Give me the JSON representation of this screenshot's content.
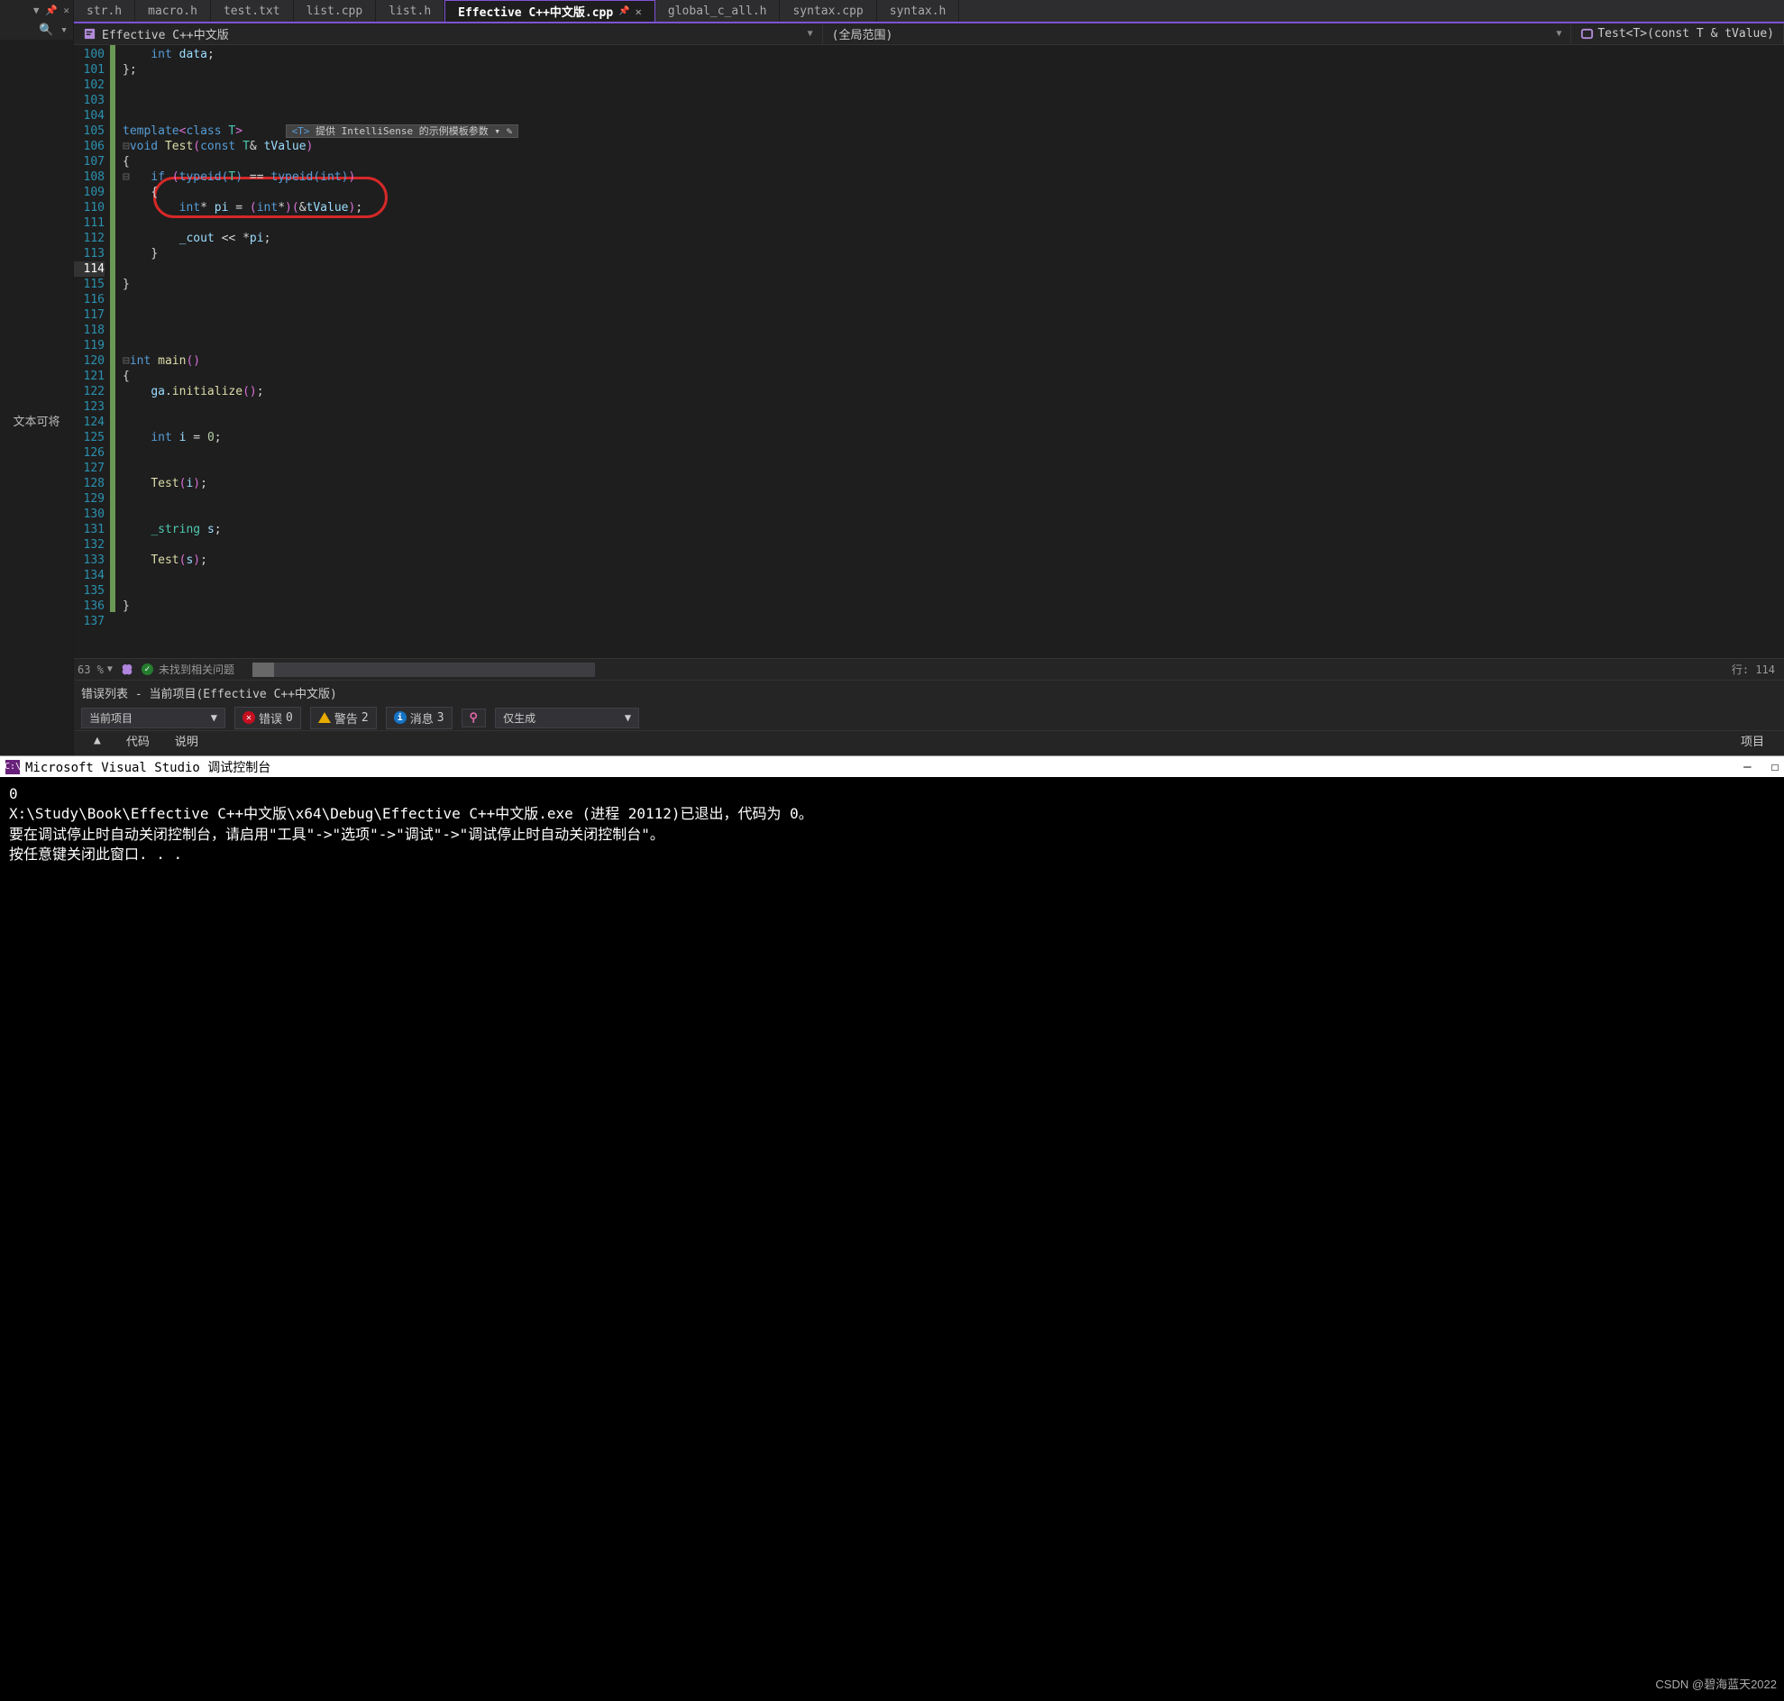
{
  "leftpane": {
    "top_icons": "▼   📌   ✕",
    "search_icon": "🔍 ▾",
    "body_text": "文本可将"
  },
  "tabs": [
    {
      "label": "str.h",
      "active": false
    },
    {
      "label": "macro.h",
      "active": false
    },
    {
      "label": "test.txt",
      "active": false
    },
    {
      "label": "list.cpp",
      "active": false
    },
    {
      "label": "list.h",
      "active": false
    },
    {
      "label": "Effective C++中文版.cpp",
      "active": true,
      "pinned": true,
      "closable": true
    },
    {
      "label": "global_c_all.h",
      "active": false
    },
    {
      "label": "syntax.cpp",
      "active": false
    },
    {
      "label": "syntax.h",
      "active": false
    }
  ],
  "navbar": {
    "left": "Effective C++中文版",
    "mid": "(全局范围)",
    "right": "Test<T>(const T & tValue)"
  },
  "gutter_start": 100,
  "gutter_end": 137,
  "active_line": 114,
  "margin_green": [
    100,
    101,
    102,
    103,
    104,
    105,
    106,
    107,
    108,
    109,
    110,
    111,
    112,
    113,
    114,
    115,
    116,
    117,
    118,
    119,
    120,
    121,
    122,
    123,
    124,
    125,
    126,
    127,
    128,
    129,
    130,
    131,
    132,
    133,
    134,
    135,
    136
  ],
  "intellisense": {
    "prefix": "<T>",
    "text": "提供 IntelliSense 的示例模板参数",
    "suffix": " ▾ ✎"
  },
  "editor_status": {
    "zoom": "63 %",
    "issues": "未找到相关问题",
    "curpos": "行: 114"
  },
  "errorlist": {
    "title": "错误列表 - 当前项目(Effective C++中文版)",
    "scope": "当前项目",
    "err_label": "错误",
    "err_count": "0",
    "warn_label": "警告",
    "warn_count": "2",
    "info_label": "消息",
    "info_count": "3",
    "build": "仅生成",
    "cols": {
      "arrow": "▲",
      "code": "代码",
      "desc": "说明",
      "proj": "项目"
    }
  },
  "console": {
    "title": "Microsoft Visual Studio 调试控制台",
    "lines": [
      "0",
      "X:\\Study\\Book\\Effective C++中文版\\x64\\Debug\\Effective C++中文版.exe (进程 20112)已退出，代码为 0。",
      "要在调试停止时自动关闭控制台，请启用\"工具\"->\"选项\"->\"调试\"->\"调试停止时自动关闭控制台\"。",
      "按任意键关闭此窗口. . ."
    ]
  },
  "watermark": "CSDN @碧海蓝天2022"
}
